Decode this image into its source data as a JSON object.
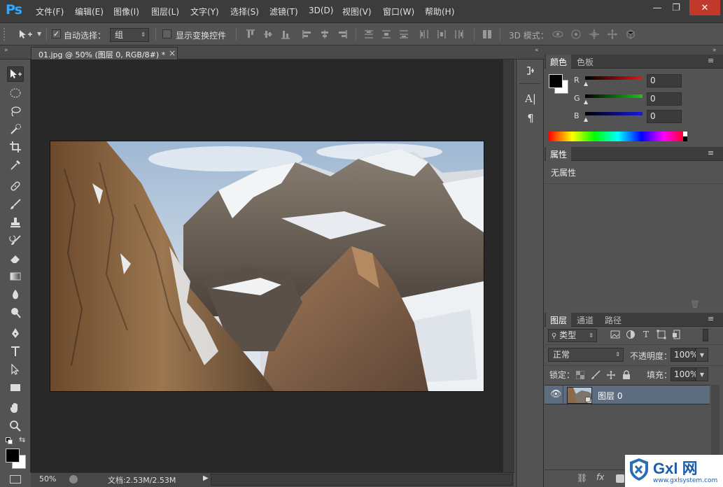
{
  "app": {
    "logo": "Ps"
  },
  "menu": [
    "文件(F)",
    "编辑(E)",
    "图像(I)",
    "图层(L)",
    "文字(Y)",
    "选择(S)",
    "滤镜(T)",
    "3D(D)",
    "视图(V)",
    "窗口(W)",
    "帮助(H)"
  ],
  "window_controls": {
    "minimize": "—",
    "restore": "❐",
    "close": "✕"
  },
  "options": {
    "auto_select_label": "自动选择：",
    "auto_select_checked": true,
    "auto_select_value": "组",
    "show_transform_label": "显示变换控件",
    "show_transform_checked": false,
    "mode_3d_label": "3D 模式："
  },
  "document": {
    "tab_title": "01.jpg @ 50% (图层 0, RGB/8#) *",
    "tab_close": "×",
    "zoom": "50%",
    "doc_info": "文档:2.53M/2.53M"
  },
  "color_panel": {
    "tabs": [
      "颜色",
      "色板"
    ],
    "channels": [
      {
        "label": "R",
        "value": "0",
        "color": "#e81414"
      },
      {
        "label": "G",
        "value": "0",
        "color": "#16c716"
      },
      {
        "label": "B",
        "value": "0",
        "color": "#1818e0"
      }
    ],
    "foreground": "#000000",
    "background": "#ffffff"
  },
  "properties_panel": {
    "tab": "属性",
    "content": "无属性"
  },
  "layers_panel": {
    "tabs": [
      "图层",
      "通道",
      "路径"
    ],
    "filter_label": "类型",
    "blend_mode": "正常",
    "opacity_label": "不透明度：",
    "opacity_value": "100%",
    "lock_label": "锁定：",
    "fill_label": "填充：",
    "fill_value": "100%",
    "layers": [
      {
        "name": "图层 0",
        "visible": true
      }
    ]
  },
  "watermark": {
    "text": "Gxl 网",
    "url": "www.gxlsystem.com"
  }
}
